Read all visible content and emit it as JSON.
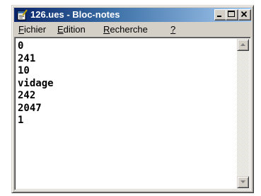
{
  "window": {
    "title": "126.ues - Bloc-notes",
    "app_icon": "notepad-icon",
    "controls": [
      "minimize-icon",
      "maximize-icon",
      "close-icon"
    ]
  },
  "menu": [
    {
      "first": "F",
      "rest": "ichier"
    },
    {
      "first": "E",
      "rest": "dition"
    },
    {
      "first": "R",
      "rest": "echerche"
    },
    {
      "first": "?",
      "rest": ""
    }
  ],
  "content": {
    "lines": [
      "0",
      "241",
      "10",
      "vidage",
      "242",
      "2047",
      "1"
    ]
  },
  "colors": {
    "titlebar_start": "#0a246a",
    "titlebar_end": "#a6caf0",
    "chrome": "#d4d0c8"
  }
}
